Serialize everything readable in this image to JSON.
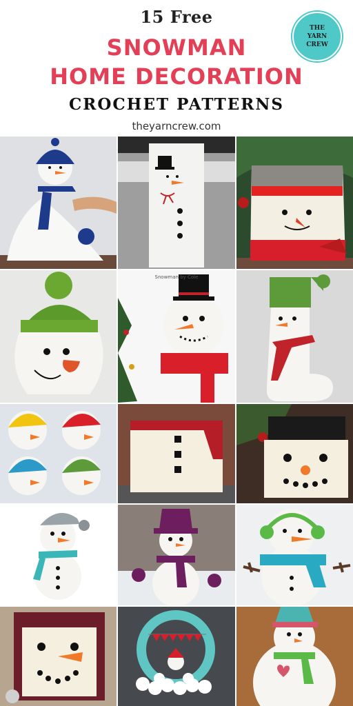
{
  "header": {
    "pre_title": "15 Free",
    "title_line1": "SNOWMAN",
    "title_line2": "HOME DECORATION",
    "subtitle": "CROCHET PATTERNS",
    "url": "theyarncrew.com"
  },
  "badge": {
    "line1": "THE",
    "line2": "YARN",
    "line3": "CREW"
  },
  "photos": {
    "p1": {
      "caption": ""
    },
    "p2": {
      "caption": ""
    },
    "p5": {
      "caption": "Snowman by Cole"
    },
    "p7": {
      "caption": ""
    },
    "p15": {
      "caption": ""
    }
  },
  "colors": {
    "accent": "#e34057",
    "badge": "#4ec9c8"
  }
}
